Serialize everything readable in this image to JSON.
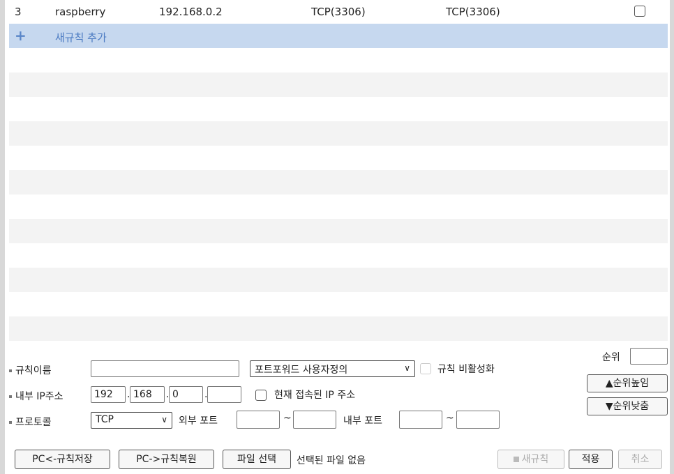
{
  "rule_row": {
    "num": "3",
    "name": "raspberry",
    "ip": "192.168.0.2",
    "ext_port": "TCP(3306)",
    "int_port": "TCP(3306)"
  },
  "add_rule": {
    "icon": "+",
    "label": "새규칙 추가"
  },
  "form": {
    "rule_name_label": "규칙이름",
    "rule_name_value": "",
    "forward_type": "포트포워드 사용자정의",
    "disable_label": "규칙 비활성화",
    "internal_ip_label": "내부 IP주소",
    "ip1": "192",
    "ip2": "168",
    "ip3": "0",
    "ip4": "",
    "current_ip_label": "현재 접속된 IP 주소",
    "protocol_label": "프로토콜",
    "protocol_value": "TCP",
    "ext_port_label": "외부 포트",
    "int_port_label": "내부 포트",
    "tilde": "~",
    "order_label": "순위",
    "order_up": "▲순위높임",
    "order_down": "▼순위낮춤"
  },
  "buttons": {
    "save_rules": "PC<-규칙저장",
    "restore_rules": "PC->규칙복원",
    "choose_file": "파일 선택",
    "no_file": "선택된 파일 없음",
    "new_rule": "새규칙",
    "apply": "적용",
    "cancel": "취소"
  }
}
